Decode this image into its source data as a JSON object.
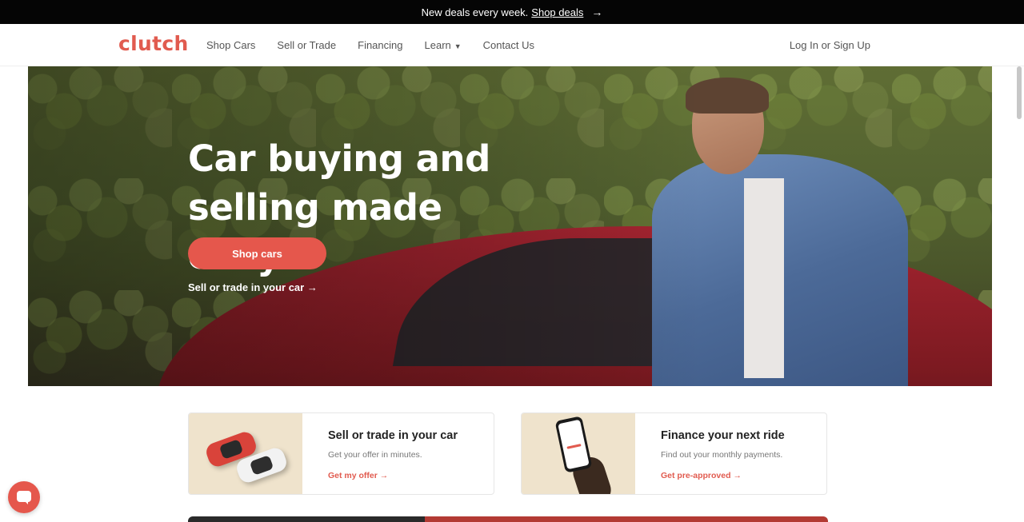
{
  "promo": {
    "text": "New deals every week.",
    "link": "Shop deals"
  },
  "nav": {
    "logo": "clutch",
    "items": [
      {
        "label": "Shop Cars"
      },
      {
        "label": "Sell or Trade"
      },
      {
        "label": "Financing"
      },
      {
        "label": "Learn"
      },
      {
        "label": "Contact Us"
      }
    ],
    "login": "Log In or Sign Up"
  },
  "hero": {
    "title": "Car buying and selling made easy",
    "cta": "Shop cars",
    "link": "Sell or trade in your car"
  },
  "cards": [
    {
      "title": "Sell or trade in your car",
      "subtitle": "Get your offer in minutes.",
      "cta": "Get my offer"
    },
    {
      "title": "Finance your next ride",
      "subtitle": "Find out your monthly payments.",
      "cta": "Get pre-approved"
    }
  ],
  "colors": {
    "brand": "#e15b4f",
    "promo_bg": "#050505"
  },
  "icons": {
    "promo_arrow": "arrow-right-icon",
    "learn_chevron": "chevron-down-icon",
    "chat": "chat-icon"
  }
}
